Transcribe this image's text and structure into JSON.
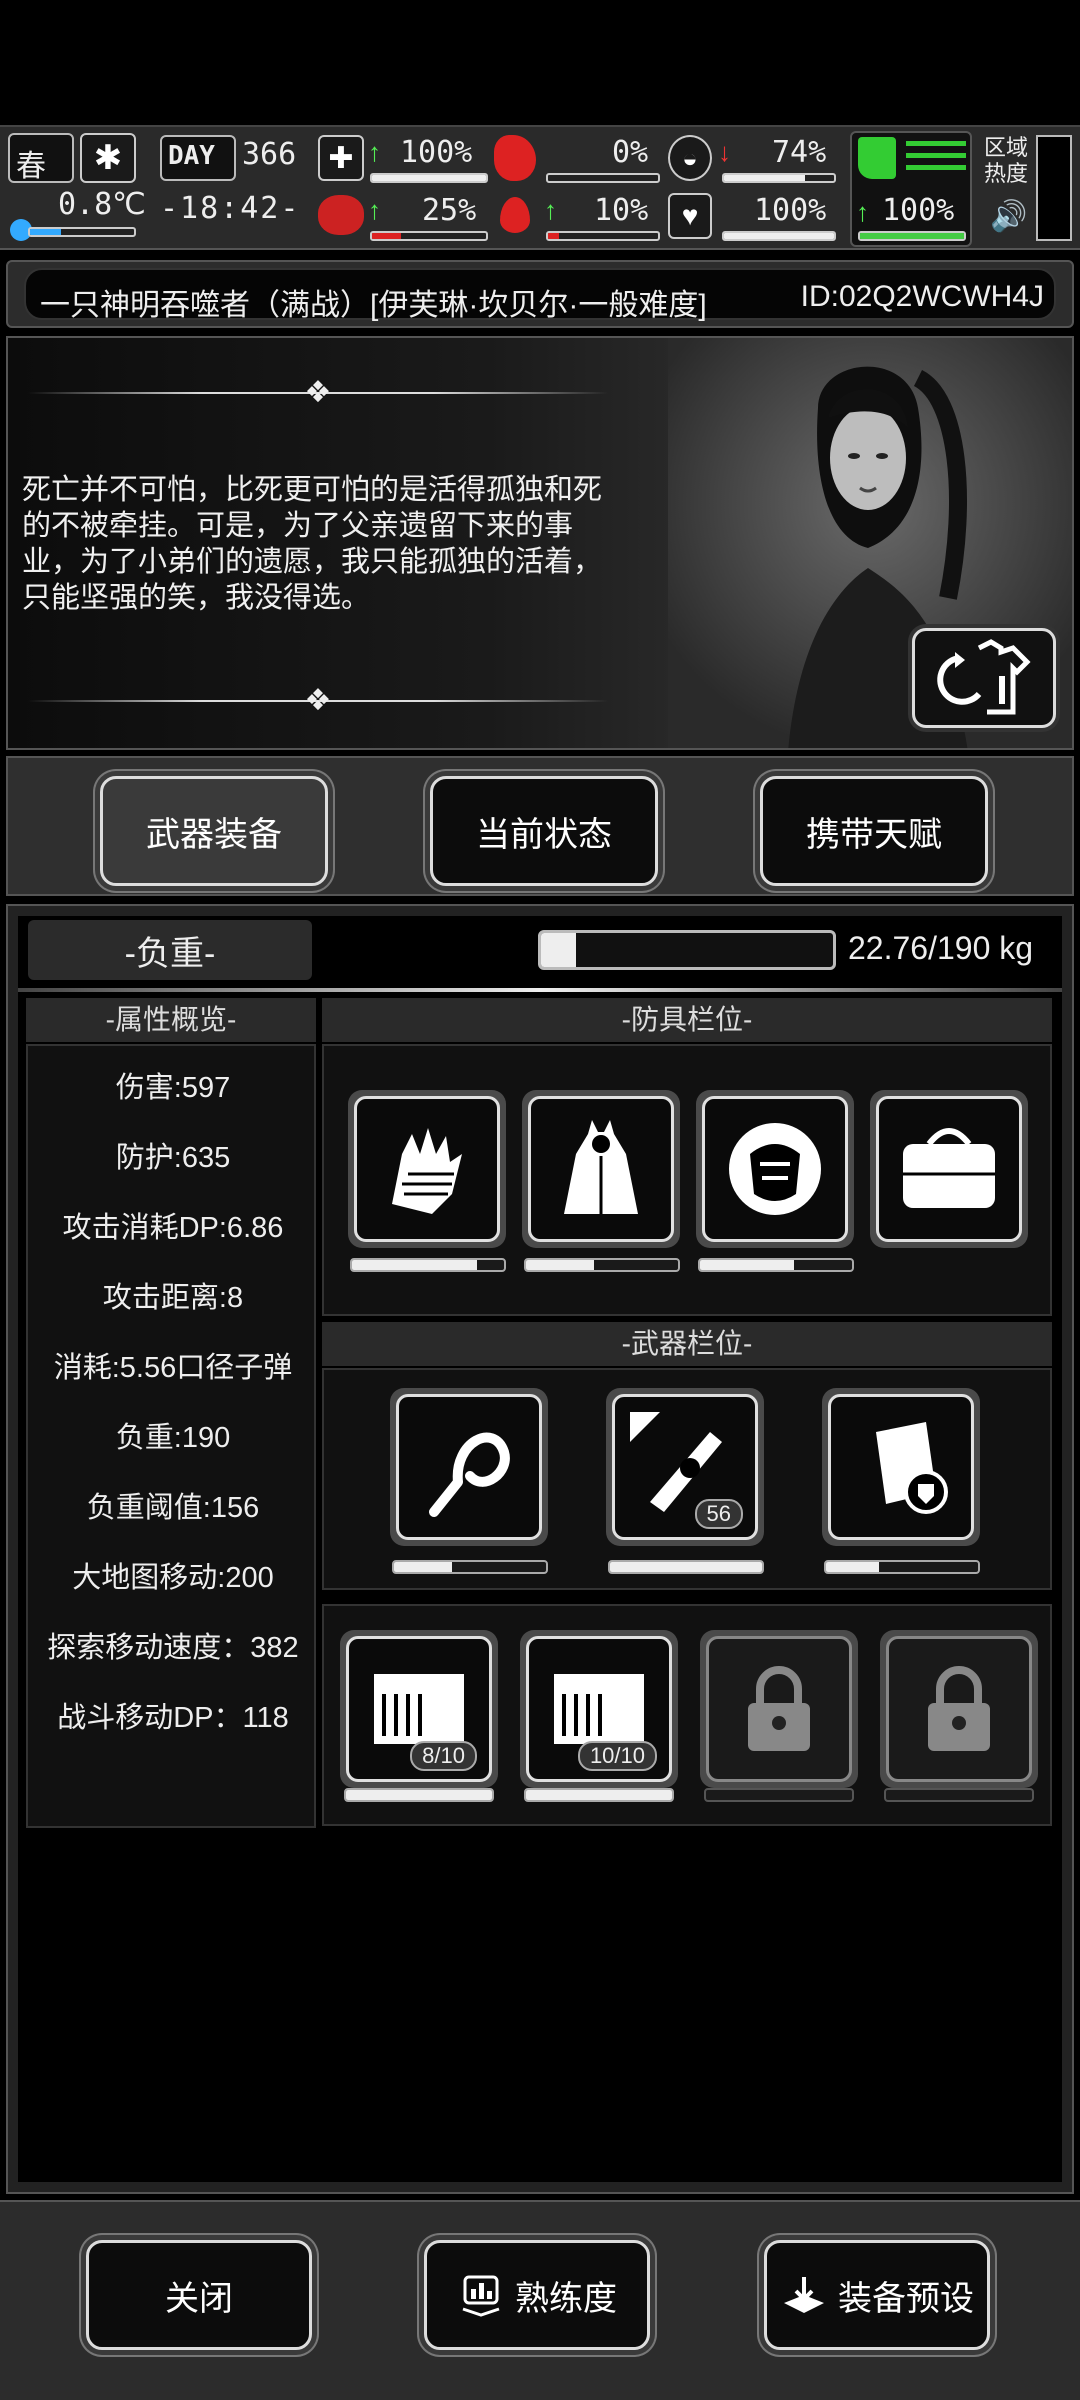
{
  "status": {
    "season": "春",
    "day_label": "DAY",
    "day_value": "366",
    "temperature": "0.8℃",
    "time": "-18:42-",
    "stats": [
      {
        "icon": "medkit-icon",
        "trend": "up",
        "value": "100%",
        "fill": 1.0,
        "color": "white"
      },
      {
        "icon": "stomach-icon",
        "trend": "none",
        "value": "0%",
        "fill": 0.0,
        "color": "white"
      },
      {
        "icon": "bladder-icon",
        "trend": "down",
        "value": "74%",
        "fill": 0.74,
        "color": "white"
      },
      {
        "icon": "brain-icon",
        "trend": "up",
        "value": "25%",
        "fill": 0.25,
        "color": "red"
      },
      {
        "icon": "blood-drop-icon",
        "trend": "up",
        "value": "10%",
        "fill": 0.1,
        "color": "red"
      },
      {
        "icon": "heart-icon",
        "trend": "none",
        "value": "100%",
        "fill": 1.0,
        "color": "white"
      },
      {
        "icon": "boot-icon",
        "trend": "up",
        "value": "100%",
        "fill": 1.0,
        "color": "green"
      }
    ],
    "area_heat_label": "区域热度"
  },
  "title": {
    "text": "一只神明吞噬者（满战）[伊芙琳·坎贝尔·一般难度]",
    "id": "ID:02Q2WCWH4J"
  },
  "story": {
    "text": "死亡并不可怕，比死更可怕的是活得孤独和死的不被牵挂。可是，为了父亲遗留下来的事业，为了小弟们的遗愿，我只能孤独的活着，只能坚强的笑，我没得选。"
  },
  "tabs": [
    "武器装备",
    "当前状态",
    "携带天赋"
  ],
  "load": {
    "label": "-负重-",
    "value": "22.76/190 kg",
    "fill": 0.12
  },
  "attributes": {
    "header": "-属性概览-",
    "items": [
      "伤害:597",
      "防护:635",
      "攻击消耗DP:6.86",
      "攻击距离:8",
      "消耗:5.56口径子弹",
      "负重:190",
      "负重阈值:156",
      "大地图移动:200",
      "探索移动速度：382",
      "战斗移动DP：118"
    ]
  },
  "armor": {
    "header": "-防具栏位-",
    "slots": [
      {
        "icon": "gloves-icon",
        "durability": 0.82
      },
      {
        "icon": "hooded-coat-icon",
        "durability": 0.45
      },
      {
        "icon": "armor-plate-icon",
        "durability": 0.62
      },
      {
        "icon": "bag-icon",
        "durability": null
      }
    ]
  },
  "weapons": {
    "header": "-武器栏位-",
    "slots": [
      {
        "icon": "whip-icon",
        "durability": 0.38,
        "badge": ""
      },
      {
        "icon": "gun-icon",
        "durability": 1.0,
        "badge": "56"
      },
      {
        "icon": "shield-kit-icon",
        "durability": 0.35,
        "badge": ""
      }
    ],
    "ammo": [
      {
        "icon": "ammo-box-icon",
        "count": "8/10",
        "durability": 1.0
      },
      {
        "icon": "ammo-box-icon",
        "count": "10/10",
        "durability": 1.0
      },
      {
        "icon": "lock-icon",
        "count": "",
        "durability": 0
      },
      {
        "icon": "lock-icon",
        "count": "",
        "durability": 0
      }
    ]
  },
  "footer": {
    "close": "关闭",
    "proficiency": "熟练度",
    "preset": "装备预设"
  }
}
